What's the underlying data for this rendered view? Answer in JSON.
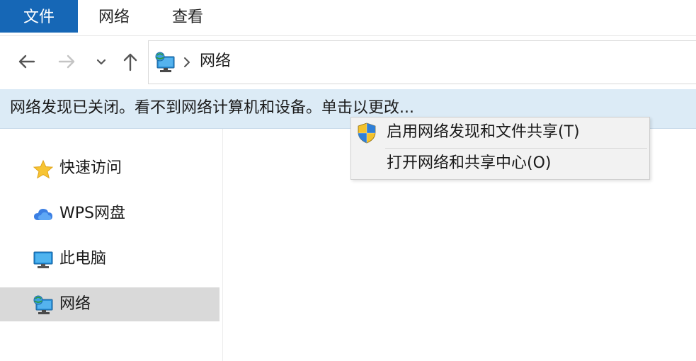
{
  "ribbon": {
    "tabs": [
      {
        "label": "文件",
        "active": true
      },
      {
        "label": "网络",
        "active": false
      },
      {
        "label": "查看",
        "active": false
      }
    ]
  },
  "address_bar": {
    "location": "网络",
    "icons": [
      "back-arrow-icon",
      "forward-arrow-icon",
      "recent-locations-icon",
      "up-arrow-icon",
      "network-icon",
      "chevron-right-icon"
    ]
  },
  "info_bar": {
    "message": "网络发现已关闭。看不到网络计算机和设备。单击以更改..."
  },
  "sidebar": {
    "items": [
      {
        "label": "快速访问",
        "icon": "star-icon",
        "selected": false
      },
      {
        "label": "WPS网盘",
        "icon": "cloud-icon",
        "selected": false
      },
      {
        "label": "此电脑",
        "icon": "monitor-icon",
        "selected": false
      },
      {
        "label": "网络",
        "icon": "network-icon",
        "selected": true
      }
    ]
  },
  "context_menu": {
    "items": [
      {
        "label": "启用网络发现和文件共享(T)",
        "icon": "uac-shield-icon"
      },
      {
        "label": "打开网络和共享中心(O)",
        "icon": ""
      }
    ]
  },
  "colors": {
    "accent": "#1667b6",
    "info_bar_bg": "#dcebf6",
    "selected_bg": "#d9d9d9",
    "menu_bg": "#f2f2f2"
  }
}
